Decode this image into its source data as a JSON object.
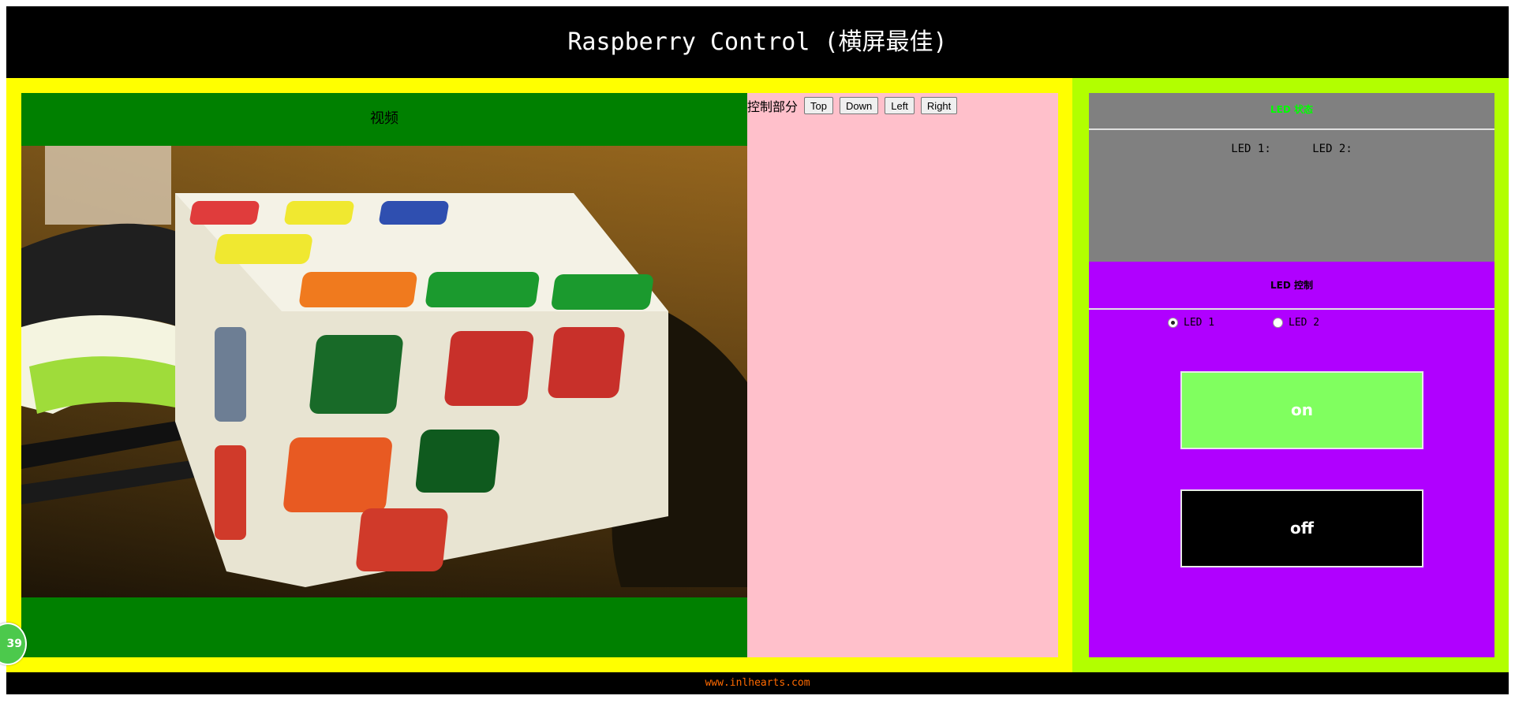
{
  "header": {
    "title": "Raspberry Control (横屏最佳)"
  },
  "video": {
    "title": "视频",
    "feed_name": "camera-stream"
  },
  "controls": {
    "label": "控制部分",
    "buttons": [
      {
        "label": "Top"
      },
      {
        "label": "Down"
      },
      {
        "label": "Left"
      },
      {
        "label": "Right"
      }
    ]
  },
  "led_status": {
    "title": "LED 状态",
    "items": [
      {
        "label": "LED 1:"
      },
      {
        "label": "LED 2:"
      }
    ]
  },
  "led_control": {
    "title": "LED 控制",
    "options": [
      {
        "label": "LED 1",
        "checked": true
      },
      {
        "label": "LED 2",
        "checked": false
      }
    ],
    "on_label": "on",
    "off_label": "off"
  },
  "footer": {
    "text": "www.inlhearts.com"
  },
  "badge": {
    "text": "39"
  },
  "colors": {
    "header_bg": "#000000",
    "left_bg": "#ffff00",
    "right_bg": "#b2ff00",
    "video_panel": "#008000",
    "control_panel": "#ffc0cb",
    "status_panel": "#808080",
    "status_title": "#00ff00",
    "control_led_panel": "#b000ff",
    "on_button": "#80ff5f",
    "off_button": "#000000",
    "footer_text": "#ff6a00"
  }
}
